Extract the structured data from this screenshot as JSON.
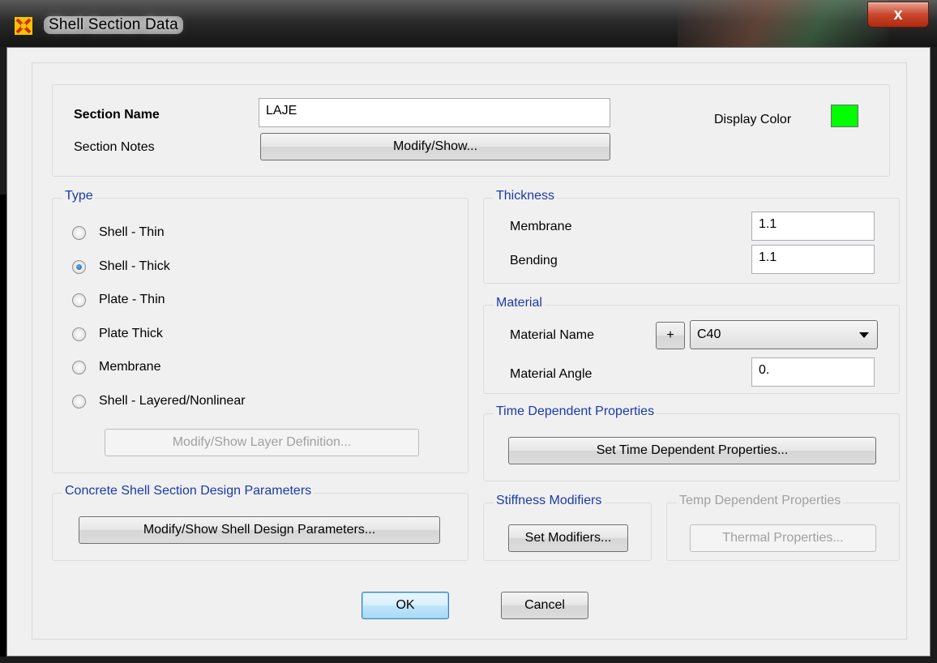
{
  "window": {
    "title": "Shell Section Data",
    "close_label": "x"
  },
  "header": {
    "section_name_label": "Section Name",
    "section_name_value": "LAJE",
    "section_notes_label": "Section Notes",
    "modify_show_label": "Modify/Show...",
    "display_color_label": "Display Color",
    "display_color": "#00ff00"
  },
  "type_group": {
    "title": "Type",
    "options": [
      "Shell - Thin",
      "Shell - Thick",
      "Plate - Thin",
      "Plate Thick",
      "Membrane",
      "Shell - Layered/Nonlinear"
    ],
    "selected": "Shell - Thick",
    "layer_button": "Modify/Show Layer Definition..."
  },
  "thickness": {
    "title": "Thickness",
    "membrane_label": "Membrane",
    "membrane_value": "1.1",
    "bending_label": "Bending",
    "bending_value": "1.1"
  },
  "material": {
    "title": "Material",
    "name_label": "Material Name",
    "add_label": "+",
    "name_value": "C40",
    "angle_label": "Material Angle",
    "angle_value": "0."
  },
  "time_dependent": {
    "title": "Time Dependent Properties",
    "button": "Set Time Dependent Properties..."
  },
  "concrete": {
    "title": "Concrete Shell Section Design Parameters",
    "button": "Modify/Show Shell Design Parameters..."
  },
  "stiffness": {
    "title": "Stiffness Modifiers",
    "button": "Set Modifiers..."
  },
  "temp_dependent": {
    "title": "Temp Dependent Properties",
    "button": "Thermal Properties..."
  },
  "footer": {
    "ok": "OK",
    "cancel": "Cancel"
  }
}
